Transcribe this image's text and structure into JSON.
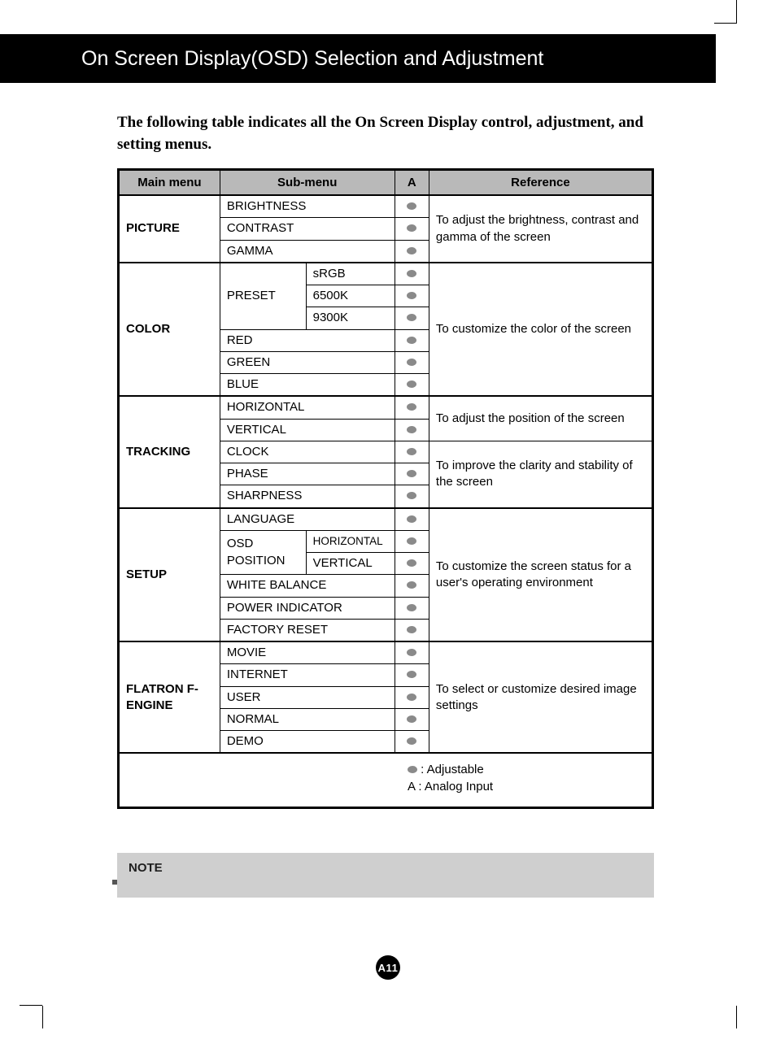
{
  "header": {
    "title": "On Screen Display(OSD) Selection and Adjustment"
  },
  "intro": "The following table indicates all the On Screen Display control, adjustment, and setting menus.",
  "table": {
    "headers": {
      "main": "Main menu",
      "sub": "Sub-menu",
      "a": "A",
      "ref": "Reference"
    },
    "picture": {
      "label": "PICTURE",
      "items": [
        "BRIGHTNESS",
        "CONTRAST",
        "GAMMA"
      ],
      "ref": "To adjust the brightness, contrast and gamma of the screen"
    },
    "color": {
      "label": "COLOR",
      "preset_label": "PRESET",
      "presets": [
        "sRGB",
        "6500K",
        "9300K"
      ],
      "items": [
        "RED",
        "GREEN",
        "BLUE"
      ],
      "ref": "To customize the color of the screen"
    },
    "tracking": {
      "label": "TRACKING",
      "items": [
        "HORIZONTAL",
        "VERTICAL",
        "CLOCK",
        "PHASE",
        "SHARPNESS"
      ],
      "ref1": "To adjust the position of the screen",
      "ref2": "To improve the clarity and stability of the screen"
    },
    "setup": {
      "label": "SETUP",
      "items_before": [
        "LANGUAGE"
      ],
      "osd_label": "OSD POSITION",
      "osd_items": [
        "HORIZONTAL",
        "VERTICAL"
      ],
      "items_after": [
        "WHITE BALANCE",
        "POWER INDICATOR",
        "FACTORY RESET"
      ],
      "ref": "To customize the screen status for a user's operating environment"
    },
    "fengine": {
      "label": "FLATRON F-ENGINE",
      "items": [
        "MOVIE",
        "INTERNET",
        "USER",
        "NORMAL",
        "DEMO"
      ],
      "ref": "To select or customize desired image settings"
    },
    "legend": {
      "adjustable": ": Adjustable",
      "analog": "A : Analog Input"
    }
  },
  "note": {
    "title": "NOTE"
  },
  "page_number": "A11"
}
